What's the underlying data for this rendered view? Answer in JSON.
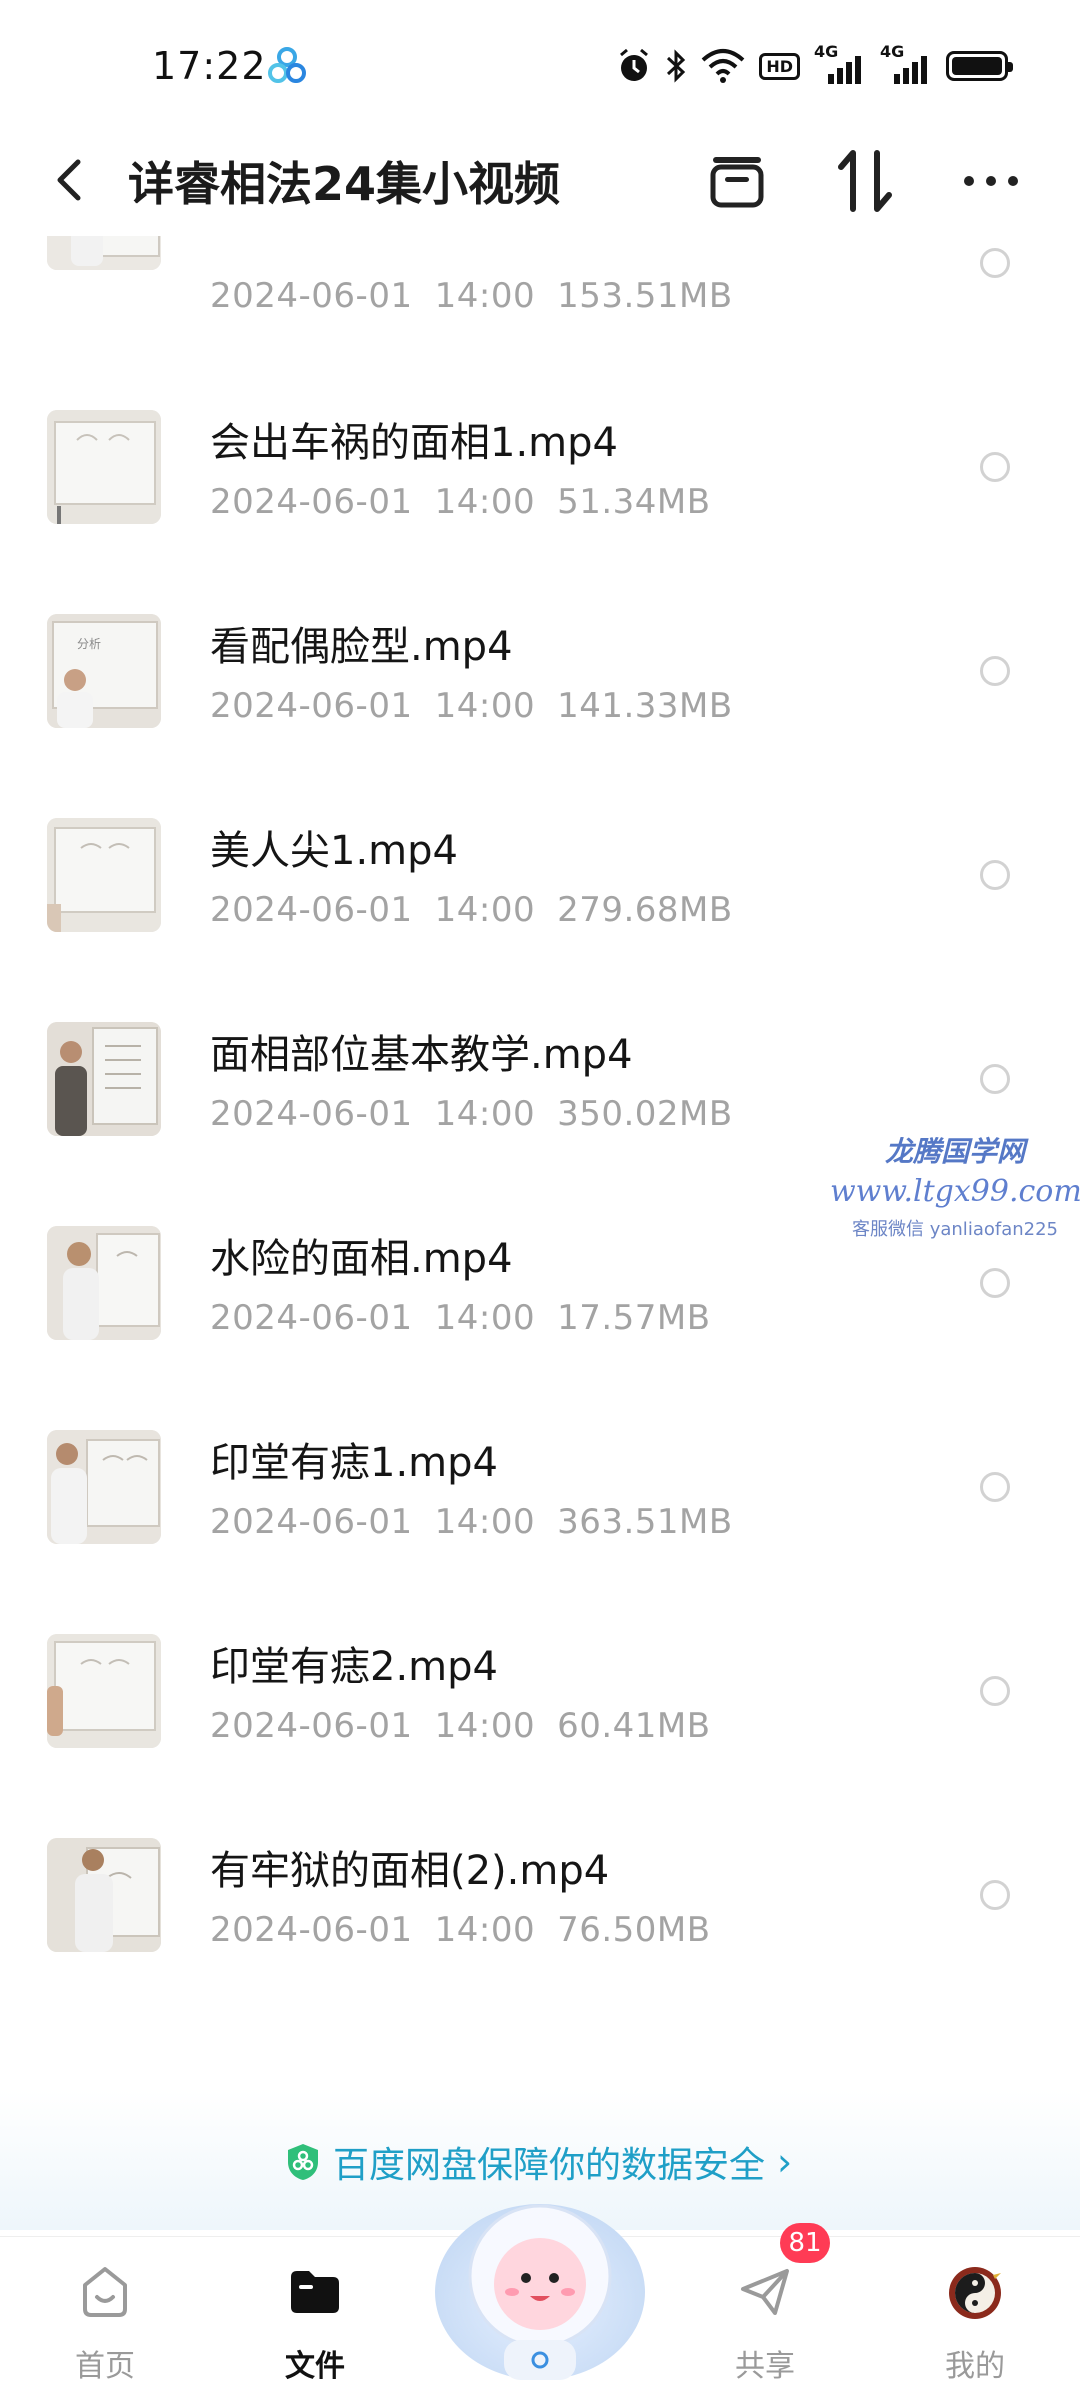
{
  "status_bar": {
    "time": "17:22",
    "network_label_1": "4G",
    "network_label_2": "4G",
    "hd_label": "HD"
  },
  "header": {
    "title": "详睿相法24集小视频"
  },
  "files": [
    {
      "name": "",
      "date": "2024-06-01",
      "time": "14:00",
      "size": "153.51MB"
    },
    {
      "name": "会出车祸的面相1.mp4",
      "date": "2024-06-01",
      "time": "14:00",
      "size": "51.34MB"
    },
    {
      "name": "看配偶脸型.mp4",
      "date": "2024-06-01",
      "time": "14:00",
      "size": "141.33MB"
    },
    {
      "name": "美人尖1.mp4",
      "date": "2024-06-01",
      "time": "14:00",
      "size": "279.68MB"
    },
    {
      "name": "面相部位基本教学.mp4",
      "date": "2024-06-01",
      "time": "14:00",
      "size": "350.02MB"
    },
    {
      "name": "水险的面相.mp4",
      "date": "2024-06-01",
      "time": "14:00",
      "size": "17.57MB"
    },
    {
      "name": "印堂有痣1.mp4",
      "date": "2024-06-01",
      "time": "14:00",
      "size": "363.51MB"
    },
    {
      "name": "印堂有痣2.mp4",
      "date": "2024-06-01",
      "time": "14:00",
      "size": "60.41MB"
    },
    {
      "name": "有牢狱的面相(2).mp4",
      "date": "2024-06-01",
      "time": "14:00",
      "size": "76.50MB"
    }
  ],
  "watermark": {
    "line1": "龙腾国学网",
    "line2": "www.ltgx99.com",
    "line3": "客服微信 yanliaofan225"
  },
  "safety_banner": {
    "text": "百度网盘保障你的数据安全"
  },
  "bottom_nav": {
    "home": "首页",
    "files": "文件",
    "share": "共享",
    "share_badge": "81",
    "mine": "我的"
  },
  "colors": {
    "accent": "#1f9fc7",
    "badge": "#ff3b55",
    "meta_text": "#a3a3a3"
  }
}
